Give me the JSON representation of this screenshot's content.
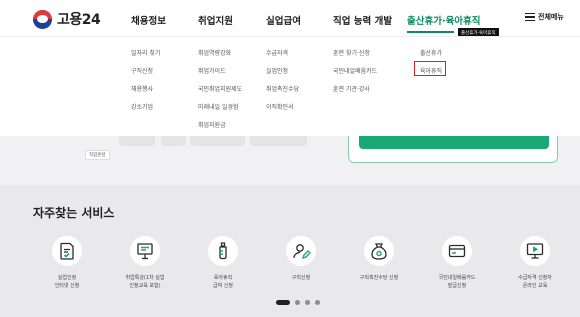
{
  "header": {
    "logo_text": "고용24",
    "nav": [
      {
        "label": "채용정보"
      },
      {
        "label": "취업지원"
      },
      {
        "label": "실업급여"
      },
      {
        "label": "직업 능력 개발"
      },
      {
        "label": "출산휴가·육아휴직",
        "active": true
      }
    ],
    "active_tooltip": "출산휴가·육아휴직",
    "all_menu_label": "전체메뉴"
  },
  "mega_menu": {
    "columns": [
      [
        "일자리 찾기",
        "구직신청",
        "채용행사",
        "강소기업"
      ],
      [
        "취업역량강화",
        "취업가이드",
        "국민취업지원제도",
        "미래내일 일경험",
        "취업지원금"
      ],
      [
        "수급자격",
        "실업인정",
        "취업촉진수당",
        "이직확인서"
      ],
      [
        "훈련 찾기·신청",
        "국민내일배움카드",
        "훈련 기관·강사"
      ],
      [
        "출산휴가",
        "육아휴직"
      ]
    ],
    "highlighted_item": "육아휴직"
  },
  "mid": {
    "chip_label": "직업훈련"
  },
  "services": {
    "title": "자주찾는 서비스",
    "items": [
      {
        "icon": "document-check-icon",
        "lines": [
          "실업인정",
          "인터넷 신청"
        ]
      },
      {
        "icon": "presentation-board-icon",
        "lines": [
          "취업특강(1차 실업",
          "인정교육 포함)"
        ]
      },
      {
        "icon": "baby-bottle-icon",
        "lines": [
          "육아휴직",
          "급여 신청"
        ]
      },
      {
        "icon": "person-edit-icon",
        "lines": [
          "구직신청"
        ]
      },
      {
        "icon": "money-bag-icon",
        "lines": [
          "구직촉진수당 신청"
        ]
      },
      {
        "icon": "credit-card-icon",
        "lines": [
          "국민내일배움카드",
          "발급신청"
        ]
      },
      {
        "icon": "monitor-play-icon",
        "lines": [
          "수급자격 신청자",
          "온라인 교육"
        ]
      }
    ],
    "carousel": {
      "pages": 4,
      "current": 1
    }
  },
  "colors": {
    "accent_green": "#0f8a5f",
    "highlight_red": "#e02020"
  }
}
